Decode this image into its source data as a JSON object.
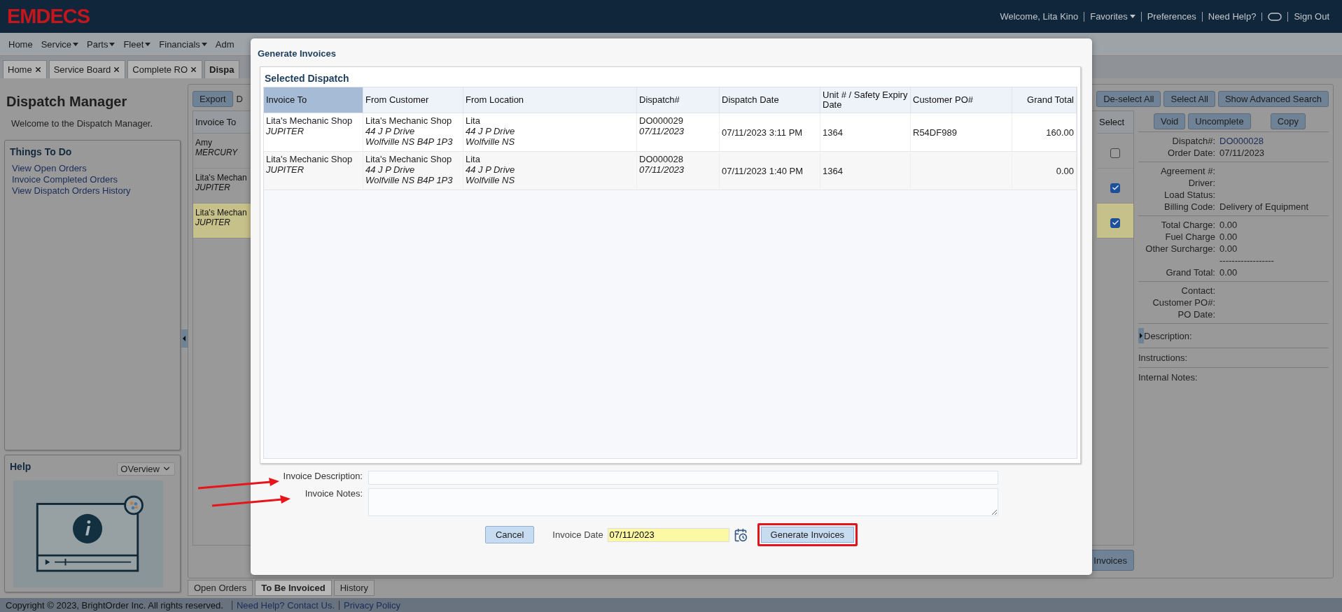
{
  "header": {
    "logo": "EMDECS",
    "items": [
      {
        "kind": "text",
        "text": "Welcome, Lita Kino"
      },
      {
        "kind": "menu",
        "text": "Favorites"
      },
      {
        "kind": "link",
        "text": "Preferences"
      },
      {
        "kind": "link",
        "text": "Need Help?"
      },
      {
        "kind": "toggle"
      },
      {
        "kind": "link",
        "text": "Sign Out"
      }
    ]
  },
  "menu": [
    {
      "label": "Home",
      "has_menu": false
    },
    {
      "label": "Service",
      "has_menu": true
    },
    {
      "label": "Parts",
      "has_menu": true
    },
    {
      "label": "Fleet",
      "has_menu": true
    },
    {
      "label": "Financials",
      "has_menu": true
    },
    {
      "label": "Adm",
      "has_menu": false
    }
  ],
  "tabs": [
    {
      "label": "Home",
      "selected": false,
      "closable": true
    },
    {
      "label": "Service Board",
      "selected": false,
      "closable": true
    },
    {
      "label": "Complete RO",
      "selected": false,
      "closable": true
    },
    {
      "label": "Dispa",
      "selected": true,
      "closable": false
    }
  ],
  "left_panel": {
    "title": "Dispatch Manager",
    "welcome": "Welcome to the Dispatch Manager.",
    "things_to_do": {
      "title": "Things To Do",
      "links": [
        "View Open Orders",
        "Invoice Completed Orders",
        "View Dispatch Orders History"
      ]
    },
    "help": {
      "title": "Help",
      "dropdown": "OVerview"
    }
  },
  "toolbar": {
    "export": "Export",
    "cut_label": "D",
    "buttons": [
      "De-select All",
      "Select All",
      "Show Advanced Search"
    ]
  },
  "grid": {
    "column_1": "Invoice To",
    "select_column": "Select",
    "rows": [
      {
        "name": "Amy",
        "location": "MERCURY",
        "checked": false,
        "selected": false
      },
      {
        "name": "Lita's Mechan",
        "location": "JUPITER",
        "checked": true,
        "selected": false
      },
      {
        "name": "Lita's Mechan",
        "location": "JUPITER",
        "checked": true,
        "selected": true
      }
    ]
  },
  "grid_button": "Invoices",
  "detail": {
    "buttons": [
      "Void",
      "Uncomplete",
      "Copy"
    ],
    "groups": [
      {
        "rows": [
          {
            "label": "Dispatch#:",
            "value": "DO000028",
            "link": true
          },
          {
            "label": "Order Date:",
            "value": "07/11/2023",
            "link": false
          }
        ]
      },
      {
        "rows": [
          {
            "label": "Agreement #:"
          },
          {
            "label": "Driver:"
          },
          {
            "label": "Load Status:"
          },
          {
            "label": "Billing Code:",
            "value": "Delivery of Equipment",
            "link": false
          }
        ]
      },
      {
        "rows": [
          {
            "label": "Total Charge:",
            "value": "0.00",
            "link": false
          },
          {
            "label": "Fuel Charge",
            "value": "0.00",
            "link": false
          },
          {
            "label": "Other Surcharge:",
            "value": "0.00",
            "link": false
          },
          {
            "value": "------------------",
            "link": false
          },
          {
            "label": "Grand Total:",
            "value": "0.00",
            "link": false
          }
        ]
      },
      {
        "rows": [
          {
            "label": "Contact:"
          },
          {
            "label": "Customer PO#:"
          },
          {
            "label": "PO Date:"
          }
        ]
      }
    ],
    "notes": [
      "Description:",
      "Instructions:",
      "Internal Notes:"
    ]
  },
  "bottom_tabs": [
    {
      "label": "Open Orders",
      "selected": false
    },
    {
      "label": "To Be Invoiced",
      "selected": true
    },
    {
      "label": "History",
      "selected": false
    }
  ],
  "footer": {
    "copyright": "Copyright © 2023, BrightOrder Inc. All rights reserved.",
    "links": [
      "Need Help? Contact Us.",
      "Privacy Policy"
    ]
  },
  "modal": {
    "title": "Generate Invoices",
    "section": "Selected Dispatch",
    "columns": [
      {
        "label": "Invoice To",
        "selected": true
      },
      {
        "label": "From Customer",
        "selected": false
      },
      {
        "label": "From Location",
        "selected": false
      },
      {
        "label": "Dispatch#",
        "selected": false
      },
      {
        "label": "Dispatch Date",
        "selected": false
      },
      {
        "label": "Unit # / Safety Expiry Date",
        "selected": false
      },
      {
        "label": "Customer PO#",
        "selected": false
      },
      {
        "label": "Grand Total",
        "selected": false
      }
    ],
    "rows": [
      {
        "invoice_to": [
          "Lita's Mechanic Shop",
          "JUPITER"
        ],
        "from_customer": [
          "Lita's Mechanic Shop",
          "44 J P Drive",
          "Wolfville NS B4P 1P3"
        ],
        "from_location": [
          "Lita",
          "44 J P Drive",
          "Wolfville NS"
        ],
        "dispatch": [
          "DO000029",
          "07/11/2023"
        ],
        "dispatch_date": "07/11/2023 3:11 PM",
        "unit": "1364",
        "customer_po": "R54DF989",
        "grand_total": "160.00"
      },
      {
        "invoice_to": [
          "Lita's Mechanic Shop",
          "JUPITER"
        ],
        "from_customer": [
          "Lita's Mechanic Shop",
          "44 J P Drive",
          "Wolfville NS B4P 1P3"
        ],
        "from_location": [
          "Lita",
          "44 J P Drive",
          "Wolfville NS"
        ],
        "dispatch": [
          "DO000028",
          "07/11/2023"
        ],
        "dispatch_date": "07/11/2023 1:40 PM",
        "unit": "1364",
        "grand_total": "0.00"
      }
    ],
    "description_label": "Invoice Description:",
    "notes_label": "Invoice Notes:",
    "cancel": "Cancel",
    "date_label": "Invoice Date",
    "date_value": "07/11/2023",
    "generate": {
      "label": "Generate Invoices",
      "marked": true
    }
  }
}
